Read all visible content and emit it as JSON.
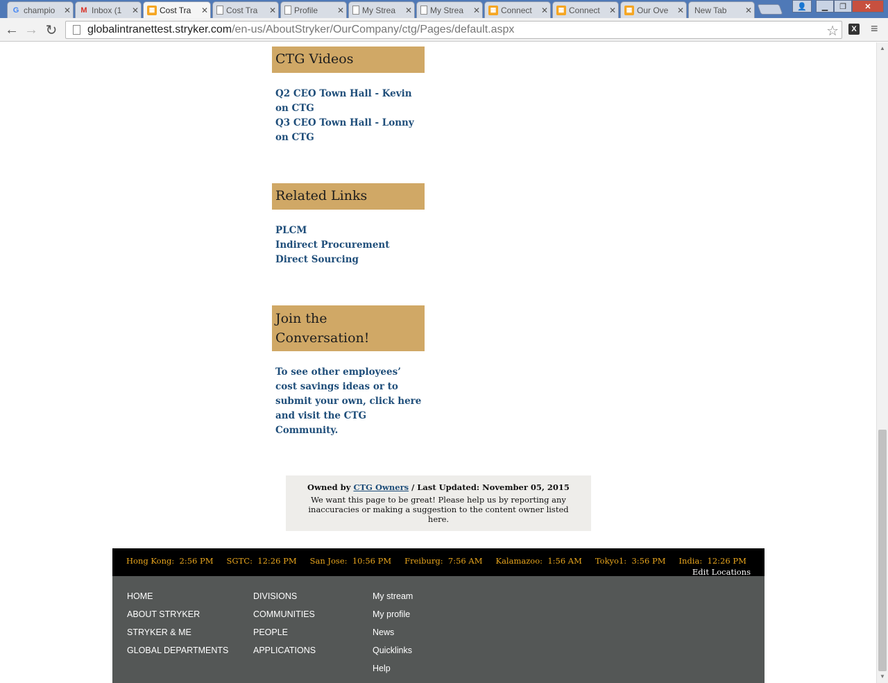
{
  "browser": {
    "tabs": [
      {
        "label": "champio",
        "icon": "google-icon"
      },
      {
        "label": "Inbox (1",
        "icon": "gmail-icon"
      },
      {
        "label": "Cost Tra",
        "icon": "sharepoint-icon",
        "active": true
      },
      {
        "label": "Cost Tra",
        "icon": "page-icon"
      },
      {
        "label": "Profile",
        "icon": "page-icon"
      },
      {
        "label": "My Strea",
        "icon": "page-icon"
      },
      {
        "label": "My Strea",
        "icon": "page-icon"
      },
      {
        "label": "Connect",
        "icon": "sharepoint-icon"
      },
      {
        "label": "Connect",
        "icon": "sharepoint-icon"
      },
      {
        "label": "Our Ove",
        "icon": "sharepoint-icon"
      },
      {
        "label": "New Tab",
        "icon": "none"
      }
    ],
    "url_host": "globalintranettest.stryker.com",
    "url_path": "/en-us/AboutStryker/OurCompany/ctg/Pages/default.aspx"
  },
  "sections": {
    "videos": {
      "title": "CTG Videos",
      "links": [
        "Q2 CEO Town Hall - Kevin on CTG",
        "Q3 CEO Town Hall - Lonny on CTG"
      ]
    },
    "related": {
      "title": "Related Links",
      "links": [
        "PLCM",
        "Indirect Procurement",
        "Direct Sourcing"
      ]
    },
    "join": {
      "title_line1": "Join the",
      "title_line2": "Conversation!",
      "text": "To see other employees’ cost savings ideas or to submit your own, click here and visit the CTG Community."
    }
  },
  "owned": {
    "prefix": "Owned by",
    "owners": "CTG Owners",
    "suffix": "/ Last Updated: November 05, 2015",
    "message": "We want this page to be great! Please help us by reporting any inaccuracies or making a suggestion to the content owner listed here."
  },
  "clocks": [
    {
      "city": "Hong Kong:",
      "time": "2:56 PM"
    },
    {
      "city": "SGTC:",
      "time": "12:26 PM"
    },
    {
      "city": "San Jose:",
      "time": "10:56 PM"
    },
    {
      "city": "Freiburg:",
      "time": "7:56 AM"
    },
    {
      "city": "Kalamazoo:",
      "time": "1:56 AM"
    },
    {
      "city": "Tokyo1:",
      "time": "3:56 PM"
    },
    {
      "city": "India:",
      "time": "12:26 PM"
    }
  ],
  "edit_locations": "Edit Locations",
  "footer": {
    "col1": [
      "HOME",
      "ABOUT STRYKER",
      "STRYKER & ME",
      "GLOBAL DEPARTMENTS"
    ],
    "col2": [
      "DIVISIONS",
      "COMMUNITIES",
      "PEOPLE",
      "APPLICATIONS"
    ],
    "col3": [
      "My stream",
      "My profile",
      "News",
      "Quicklinks",
      "Help"
    ]
  }
}
